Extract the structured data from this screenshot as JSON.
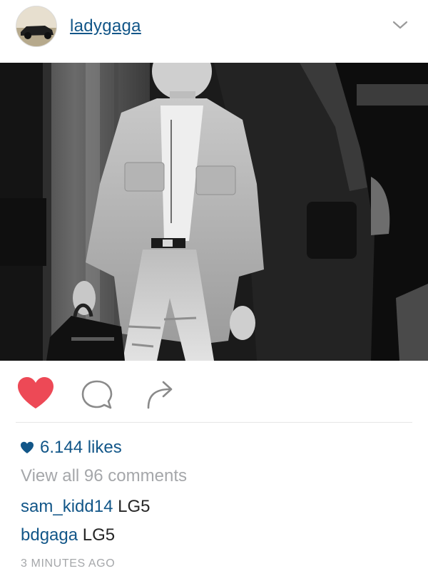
{
  "post": {
    "username": "ladygaga",
    "likes": "6.144 likes",
    "view_all_comments": "View all 96 comments",
    "comments": [
      {
        "author": "sam_kidd14",
        "text": "LG5"
      },
      {
        "author": "bdgaga",
        "text": "LG5"
      }
    ],
    "timestamp": "3 MINUTES AGO"
  },
  "icons": {
    "header": [
      "avatar",
      "chevron-down-icon"
    ],
    "actions": [
      "heart-icon",
      "comment-icon",
      "share-icon"
    ],
    "likes": "heart-icon"
  },
  "colors": {
    "link_blue": "#125688",
    "like_red": "#ed4956",
    "muted_gray": "#a5a7aa"
  }
}
